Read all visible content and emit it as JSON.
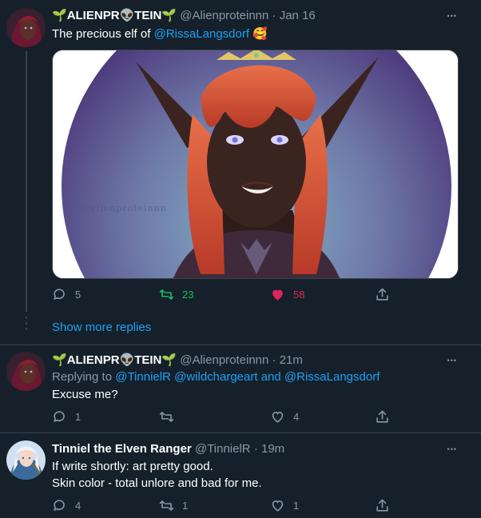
{
  "tweets": [
    {
      "name_prefix": " ",
      "name": "ALIENPR👽TEIN",
      "handle": "@Alienproteinnn",
      "dot": "·",
      "time": "Jan 16",
      "text_plain": "The precious elf of ",
      "text_mention": "@RissaLangsdorf",
      "text_emoji": "🥰",
      "watermark": "@alienproteinnn",
      "replies": "5",
      "retweets": "23",
      "likes": "58"
    },
    {
      "name": "ALIENPR👽TEIN",
      "handle": "@Alienproteinnn",
      "dot": "·",
      "time": "21m",
      "replying_to_label": "Replying to ",
      "replying_to_1": "@TinnielR",
      "replying_to_2": "@wildchargeart",
      "replying_to_and": " and ",
      "replying_to_3": "@RissaLangsdorf",
      "text": "Excuse me?",
      "replies": "1",
      "retweets": "",
      "likes": "4"
    },
    {
      "name": "Tinniel the Elven Ranger",
      "handle": "@TinnielR",
      "dot": "·",
      "time": "19m",
      "text_line1": "If write shortly: art pretty good.",
      "text_line2": "Skin color - total unlore and bad for me.",
      "replies": "4",
      "retweets": "1",
      "likes": "1"
    }
  ],
  "show_more_replies": "Show more replies",
  "colors": {
    "background": "#15202b",
    "link": "#1da1f2",
    "muted": "#8899a6",
    "retweet": "#17bf63",
    "like": "#e0245e",
    "border": "#38444d"
  }
}
